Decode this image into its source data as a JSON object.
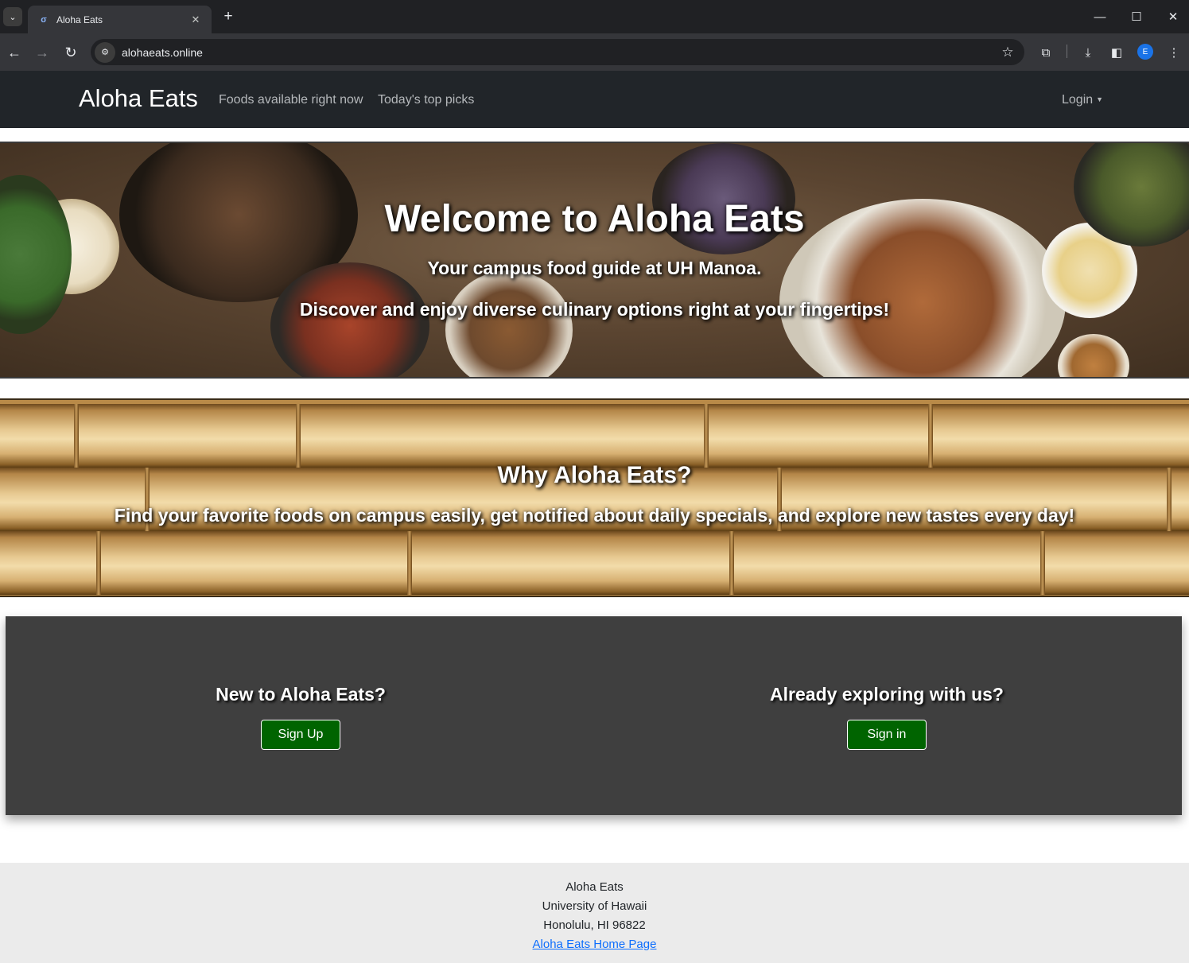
{
  "browser": {
    "tab_title": "Aloha Eats",
    "tab_close": "✕",
    "new_tab": "+",
    "url": "alohaeats.online",
    "profile_initial": "E"
  },
  "navbar": {
    "brand": "Aloha Eats",
    "links": [
      "Foods available right now",
      "Today's top picks"
    ],
    "login": "Login"
  },
  "hero": {
    "heading": "Welcome to Aloha Eats",
    "subheading": "Your campus food guide at UH Manoa.",
    "tagline": "Discover and enjoy diverse culinary options right at your fingertips!"
  },
  "why": {
    "heading": "Why Aloha Eats?",
    "text": "Find your favorite foods on campus easily, get notified about daily specials, and explore new tastes every day!"
  },
  "auth": {
    "new_heading": "New to Aloha Eats?",
    "signup_label": "Sign Up",
    "existing_heading": "Already exploring with us?",
    "signin_label": "Sign in"
  },
  "footer": {
    "line1": "Aloha Eats",
    "line2": "University of Hawaii",
    "line3": "Honolulu, HI 96822",
    "link": "Aloha Eats Home Page"
  },
  "colors": {
    "navbar_bg": "#212529",
    "auth_panel_bg": "#3f3f3f",
    "button_green": "#006400",
    "footer_bg": "#ebebeb",
    "link_blue": "#0d6efd"
  }
}
